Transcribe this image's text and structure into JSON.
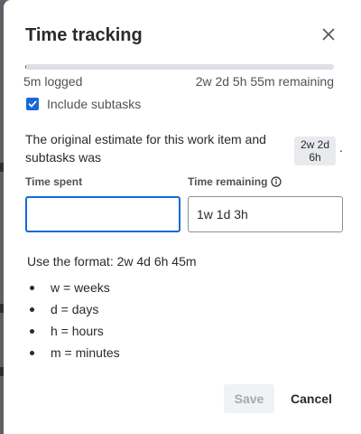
{
  "dialog": {
    "title": "Time tracking",
    "close_icon": "close-icon"
  },
  "progress": {
    "logged_fraction": 0.003,
    "logged_label": "5m logged",
    "remaining_label": "2w 2d 5h 55m remaining"
  },
  "include_subtasks": {
    "checked": true,
    "label": "Include subtasks"
  },
  "estimate": {
    "text": "The original estimate for this work item and subtasks was",
    "value_line1": "2w 2d",
    "value_line2": "6h",
    "trailing": "."
  },
  "fields": {
    "time_spent_label": "Time spent",
    "time_spent_value": "",
    "time_remaining_label": "Time remaining",
    "time_remaining_value": "1w 1d 3h",
    "info_icon": "info-icon"
  },
  "help": {
    "format": "Use the format: 2w 4d 6h 45m",
    "units": [
      "w = weeks",
      "d = days",
      "h = hours",
      "m = minutes"
    ]
  },
  "actions": {
    "save_label": "Save",
    "save_disabled": true,
    "cancel_label": "Cancel"
  },
  "colors": {
    "accent": "#1868db",
    "progress_fill": "#505258",
    "progress_track": "#dcdfe4",
    "backdrop": "#6b6e72"
  }
}
